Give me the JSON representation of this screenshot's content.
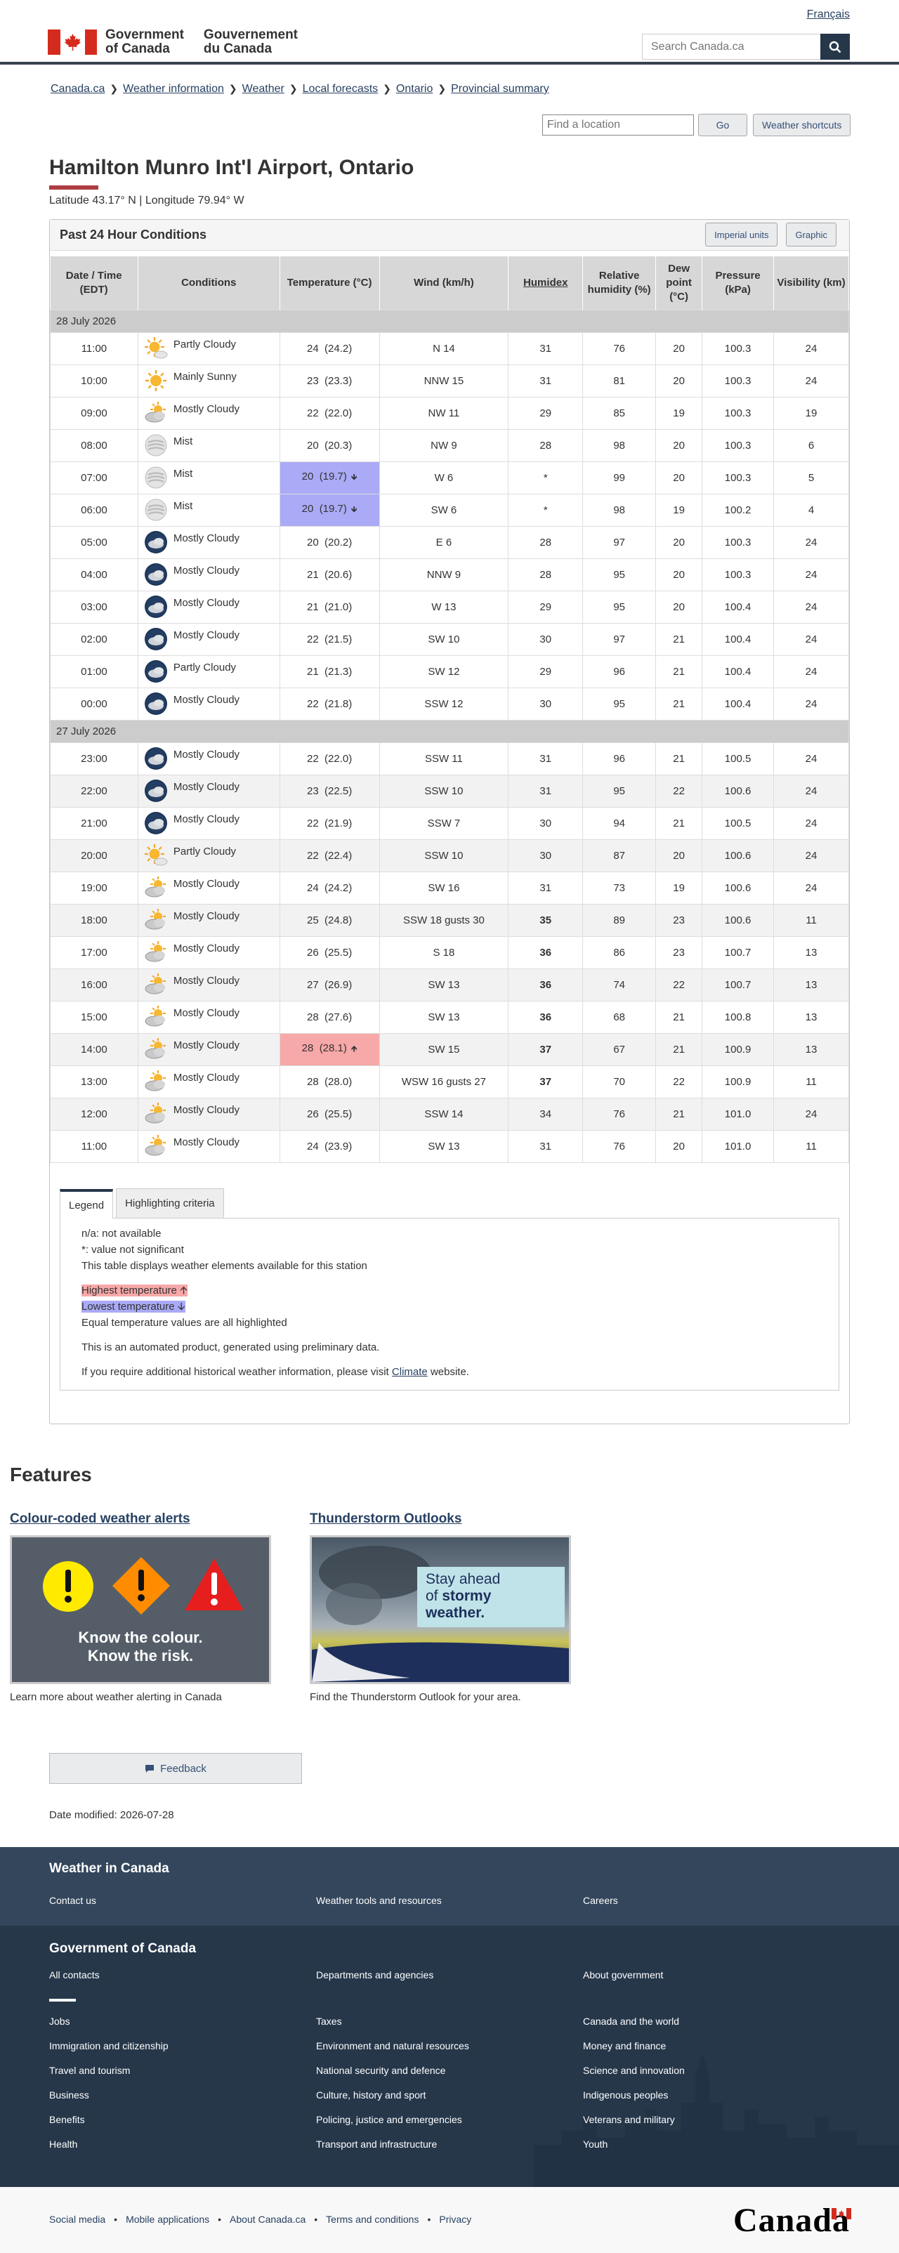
{
  "header": {
    "gov_en_1": "Government",
    "gov_en_2": "of Canada",
    "gov_fr_1": "Gouvernement",
    "gov_fr_2": "du Canada",
    "language_link": "Français",
    "search_placeholder": "Search Canada.ca"
  },
  "breadcrumb": [
    "Canada.ca",
    "Weather information",
    "Weather",
    "Local forecasts",
    "Ontario",
    "Provincial summary"
  ],
  "location_tools": {
    "placeholder": "Find a location",
    "go": "Go",
    "shortcuts": "Weather shortcuts"
  },
  "page": {
    "title": "Hamilton Munro Int'l Airport, Ontario",
    "latlon": "Latitude 43.17° N | Longitude 79.94° W"
  },
  "panel": {
    "title": "Past 24 Hour Conditions",
    "imperial": "Imperial units",
    "graphic": "Graphic"
  },
  "table": {
    "headers": [
      "Date / Time (EDT)",
      "Conditions",
      "Temperature (°C)",
      "Wind (km/h)",
      "Humidex",
      "Relative humidity (%)",
      "Dew point (°C)",
      "Pressure (kPa)",
      "Visibility (km)"
    ],
    "groups": [
      {
        "date": "28 July 2026",
        "rows": [
          {
            "time": "11:00",
            "icon": "sun-cloud",
            "cond": "Partly Cloudy",
            "temp": "24  (24.2)",
            "wind": "N 14",
            "humidex": "31",
            "rh": "76",
            "dew": "20",
            "pres": "100.3",
            "vis": "24"
          },
          {
            "time": "10:00",
            "icon": "sun",
            "cond": "Mainly Sunny",
            "temp": "23  (23.3)",
            "wind": "NNW 15",
            "humidex": "31",
            "rh": "81",
            "dew": "20",
            "pres": "100.3",
            "vis": "24"
          },
          {
            "time": "09:00",
            "icon": "cloud-sun",
            "cond": "Mostly Cloudy",
            "temp": "22  (22.0)",
            "wind": "NW 11",
            "humidex": "29",
            "rh": "85",
            "dew": "19",
            "pres": "100.3",
            "vis": "19"
          },
          {
            "time": "08:00",
            "icon": "mist",
            "cond": "Mist",
            "temp": "20  (20.3)",
            "wind": "NW 9",
            "humidex": "28",
            "rh": "98",
            "dew": "20",
            "pres": "100.3",
            "vis": "6"
          },
          {
            "time": "07:00",
            "icon": "mist",
            "cond": "Mist",
            "temp": "20  (19.7)",
            "mark": "low",
            "wind": "W 6",
            "humidex": "*",
            "rh": "99",
            "dew": "20",
            "pres": "100.3",
            "vis": "5"
          },
          {
            "time": "06:00",
            "icon": "mist",
            "cond": "Mist",
            "temp": "20  (19.7)",
            "mark": "low",
            "wind": "SW 6",
            "humidex": "*",
            "rh": "98",
            "dew": "19",
            "pres": "100.2",
            "vis": "4"
          },
          {
            "time": "05:00",
            "icon": "night-cloud",
            "cond": "Mostly Cloudy",
            "temp": "20  (20.2)",
            "wind": "E 6",
            "humidex": "28",
            "rh": "97",
            "dew": "20",
            "pres": "100.3",
            "vis": "24"
          },
          {
            "time": "04:00",
            "icon": "night-cloud",
            "cond": "Mostly Cloudy",
            "temp": "21  (20.6)",
            "wind": "NNW 9",
            "humidex": "28",
            "rh": "95",
            "dew": "20",
            "pres": "100.3",
            "vis": "24"
          },
          {
            "time": "03:00",
            "icon": "night-cloud",
            "cond": "Mostly Cloudy",
            "temp": "21  (21.0)",
            "wind": "W 13",
            "humidex": "29",
            "rh": "95",
            "dew": "20",
            "pres": "100.4",
            "vis": "24"
          },
          {
            "time": "02:00",
            "icon": "night-cloud",
            "cond": "Mostly Cloudy",
            "temp": "22  (21.5)",
            "wind": "SW 10",
            "humidex": "30",
            "rh": "97",
            "dew": "21",
            "pres": "100.4",
            "vis": "24"
          },
          {
            "time": "01:00",
            "icon": "night-cloud",
            "cond": "Partly Cloudy",
            "temp": "21  (21.3)",
            "wind": "SW 12",
            "humidex": "29",
            "rh": "96",
            "dew": "21",
            "pres": "100.4",
            "vis": "24"
          },
          {
            "time": "00:00",
            "icon": "night-cloud",
            "cond": "Mostly Cloudy",
            "temp": "22  (21.8)",
            "wind": "SSW 12",
            "humidex": "30",
            "rh": "95",
            "dew": "21",
            "pres": "100.4",
            "vis": "24"
          }
        ]
      },
      {
        "date": "27 July 2026",
        "rows": [
          {
            "time": "23:00",
            "icon": "night-cloud",
            "cond": "Mostly Cloudy",
            "temp": "22  (22.0)",
            "wind": "SSW 11",
            "humidex": "31",
            "rh": "96",
            "dew": "21",
            "pres": "100.5",
            "vis": "24"
          },
          {
            "time": "22:00",
            "icon": "night-cloud",
            "cond": "Mostly Cloudy",
            "temp": "23  (22.5)",
            "wind": "SSW 10",
            "humidex": "31",
            "rh": "95",
            "dew": "22",
            "pres": "100.6",
            "vis": "24"
          },
          {
            "time": "21:00",
            "icon": "night-cloud",
            "cond": "Mostly Cloudy",
            "temp": "22  (21.9)",
            "wind": "SSW 7",
            "humidex": "30",
            "rh": "94",
            "dew": "21",
            "pres": "100.5",
            "vis": "24"
          },
          {
            "time": "20:00",
            "icon": "sun-cloud",
            "cond": "Partly Cloudy",
            "temp": "22  (22.4)",
            "wind": "SSW 10",
            "humidex": "30",
            "rh": "87",
            "dew": "20",
            "pres": "100.6",
            "vis": "24"
          },
          {
            "time": "19:00",
            "icon": "cloud-sun",
            "cond": "Mostly Cloudy",
            "temp": "24  (24.2)",
            "wind": "SW 16",
            "humidex": "31",
            "rh": "73",
            "dew": "19",
            "pres": "100.6",
            "vis": "24"
          },
          {
            "time": "18:00",
            "icon": "cloud-sun",
            "cond": "Mostly Cloudy",
            "temp": "25  (24.8)",
            "wind": "SSW 18 gusts 30",
            "humidex": "35",
            "hbold": true,
            "rh": "89",
            "dew": "23",
            "pres": "100.6",
            "vis": "11"
          },
          {
            "time": "17:00",
            "icon": "cloud-sun",
            "cond": "Mostly Cloudy",
            "temp": "26  (25.5)",
            "wind": "S 18",
            "humidex": "36",
            "hbold": true,
            "rh": "86",
            "dew": "23",
            "pres": "100.7",
            "vis": "13"
          },
          {
            "time": "16:00",
            "icon": "cloud-sun",
            "cond": "Mostly Cloudy",
            "temp": "27  (26.9)",
            "wind": "SW 13",
            "humidex": "36",
            "hbold": true,
            "rh": "74",
            "dew": "22",
            "pres": "100.7",
            "vis": "13"
          },
          {
            "time": "15:00",
            "icon": "cloud-sun",
            "cond": "Mostly Cloudy",
            "temp": "28  (27.6)",
            "wind": "SW 13",
            "humidex": "36",
            "hbold": true,
            "rh": "68",
            "dew": "21",
            "pres": "100.8",
            "vis": "13"
          },
          {
            "time": "14:00",
            "icon": "cloud-sun",
            "cond": "Mostly Cloudy",
            "temp": "28  (28.1)",
            "mark": "high",
            "wind": "SW 15",
            "humidex": "37",
            "hbold": true,
            "rh": "67",
            "dew": "21",
            "pres": "100.9",
            "vis": "13"
          },
          {
            "time": "13:00",
            "icon": "cloud-sun",
            "cond": "Mostly Cloudy",
            "temp": "28  (28.0)",
            "wind": "WSW 16 gusts 27",
            "humidex": "37",
            "hbold": true,
            "rh": "70",
            "dew": "22",
            "pres": "100.9",
            "vis": "11"
          },
          {
            "time": "12:00",
            "icon": "cloud-sun",
            "cond": "Mostly Cloudy",
            "temp": "26  (25.5)",
            "wind": "SSW 14",
            "humidex": "34",
            "rh": "76",
            "dew": "21",
            "pres": "101.0",
            "vis": "24"
          },
          {
            "time": "11:00",
            "icon": "cloud-sun",
            "cond": "Mostly Cloudy",
            "temp": "24  (23.9)",
            "wind": "SW 13",
            "humidex": "31",
            "rh": "76",
            "dew": "20",
            "pres": "101.0",
            "vis": "11"
          }
        ]
      }
    ]
  },
  "legend": {
    "tab_legend": "Legend",
    "tab_criteria": "Highlighting criteria",
    "na": "n/a: not available",
    "star": "*: value not significant",
    "desc": "This table displays weather elements available for this station",
    "highest": "Highest temperature",
    "lowest": "Lowest temperature",
    "equal": "Equal temperature values are all highlighted",
    "automated": "This is an automated product, generated using preliminary data.",
    "historical_pre": "If you require additional historical weather information, please visit",
    "historical_link": "Climate",
    "historical_post": "website."
  },
  "features": {
    "title": "Features",
    "f1_title": "Colour-coded weather alerts",
    "f1_img_line1": "Know the colour.",
    "f1_img_line2": "Know the risk.",
    "f1_desc": "Learn more about weather alerting in Canada",
    "f2_title": "Thunderstorm Outlooks",
    "f2_img_line1": "Stay ahead",
    "f2_img_line2_pre": "of",
    "f2_img_line2_bold": "stormy",
    "f2_img_line3": "weather.",
    "f2_desc": "Find the Thunderstorm Outlook for your area."
  },
  "feedback": "Feedback",
  "date_modified": "Date modified: 2026-07-28",
  "footer": {
    "weather_title": "Weather in Canada",
    "weather_links": [
      "Contact us",
      "Weather tools and resources",
      "Careers"
    ],
    "gov_title": "Government of Canada",
    "gov_top_links": [
      "All contacts",
      "Departments and agencies",
      "About government"
    ],
    "gov_links": [
      [
        "Jobs",
        "Taxes",
        "Canada and the world"
      ],
      [
        "Immigration and citizenship",
        "Environment and natural resources",
        "Money and finance"
      ],
      [
        "Travel and tourism",
        "National security and defence",
        "Science and innovation"
      ],
      [
        "Business",
        "Culture, history and sport",
        "Indigenous peoples"
      ],
      [
        "Benefits",
        "Policing, justice and emergencies",
        "Veterans and military"
      ],
      [
        "Health",
        "Transport and infrastructure",
        "Youth"
      ]
    ],
    "bottom_links": [
      "Social media",
      "Mobile applications",
      "About Canada.ca",
      "Terms and conditions",
      "Privacy"
    ],
    "wordmark": "Canada"
  },
  "colors": {
    "header_rule": "#38414d",
    "link": "#284162",
    "footer_dark": "#26374a",
    "footer_mid": "#33465c",
    "low_temp": "#aaaaf7",
    "high_temp": "#f7a8a8"
  }
}
